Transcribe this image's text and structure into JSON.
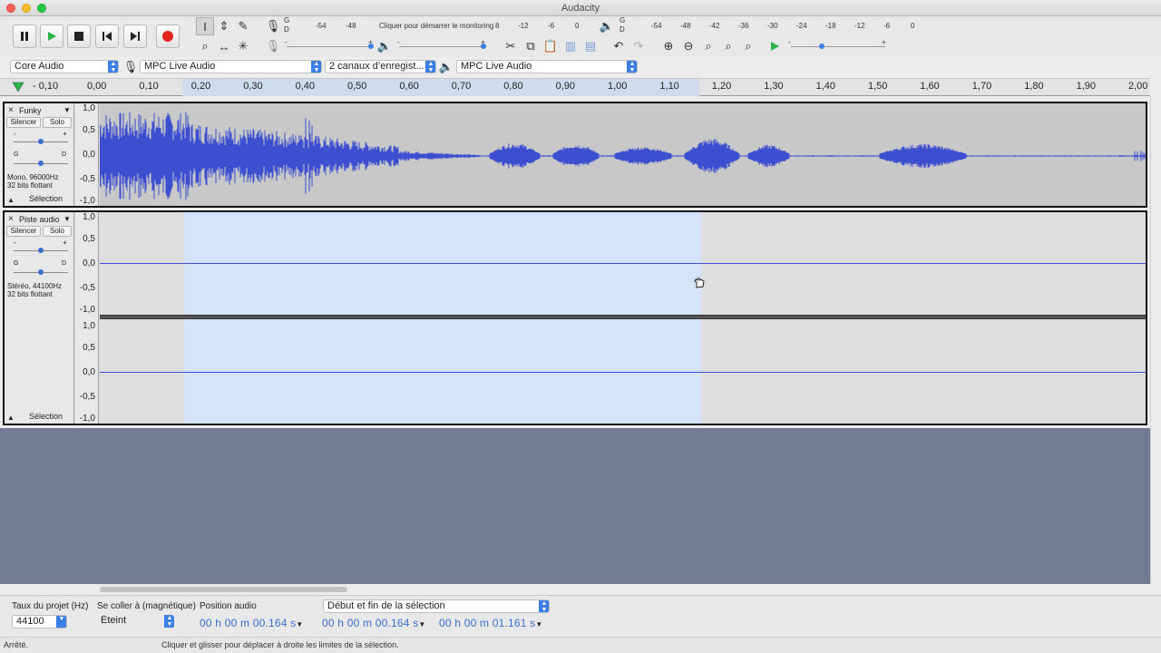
{
  "window": {
    "title": "Audacity"
  },
  "meters": {
    "record_scale": [
      "-54",
      "-48",
      "-12",
      "-6",
      "0"
    ],
    "record_hint": "Cliquer pour démarrer le monitoring",
    "record_hint_tail": "8",
    "record_L": "G",
    "record_R": "D",
    "play_scale": [
      "-54",
      "-48",
      "-42",
      "-36",
      "-30",
      "-24",
      "-18",
      "-12",
      "-6",
      "0"
    ],
    "play_L": "G",
    "play_R": "D"
  },
  "mixer": {
    "minus": "-",
    "plus": "+"
  },
  "device": {
    "host": "Core Audio",
    "input": "MPC Live Audio",
    "channels": "2 canaux d’enregist...",
    "output": "MPC Live Audio"
  },
  "ruler": {
    "ticks": [
      "- 0,10",
      "0,00",
      "0,10",
      "0,20",
      "0,30",
      "0,40",
      "0,50",
      "0,60",
      "0,70",
      "0,80",
      "0,90",
      "1,00",
      "1,10",
      "1,20",
      "1,30",
      "1,40",
      "1,50",
      "1,60",
      "1,70",
      "1,80",
      "1,90",
      "2,00"
    ]
  },
  "tracks": [
    {
      "name": "Funky",
      "close": "×",
      "mute": "Silencer",
      "solo": "Solo",
      "gain_minus": "-",
      "gain_plus": "+",
      "pan_left": "G",
      "pan_right": "D",
      "info_line1": "Mono, 96000Hz",
      "info_line2": "32 bits flottant",
      "select": "Sélection",
      "axis": [
        "1,0",
        "0,5",
        "0,0",
        "-0,5",
        "-1,0"
      ]
    },
    {
      "name": "Piste audio",
      "close": "×",
      "mute": "Silencer",
      "solo": "Solo",
      "gain_minus": "-",
      "gain_plus": "+",
      "pan_left": "G",
      "pan_right": "D",
      "info_line1": "Stéréo, 44100Hz",
      "info_line2": "32 bits flottant",
      "select": "Sélection",
      "axis_top": [
        "1,0",
        "0,5",
        "0,0",
        "-0,5",
        "-1,0"
      ],
      "axis_bottom": [
        "1,0",
        "0,5",
        "0,0",
        "-0,5",
        "-1,0"
      ]
    }
  ],
  "selection_toolbar": {
    "rate_label": "Taux du projet (Hz)",
    "rate_value": "44100",
    "snap_label": "Se coller à (magnétique)",
    "snap_value": "Éteint",
    "position_label": "Position audio",
    "position_value": "00 h 00 m 00.164 s",
    "mode_value": "Début et fin de la sélection",
    "start_value": "00 h 00 m 00.164 s",
    "end_value": "00 h 00 m 01.161 s"
  },
  "status": {
    "state": "Arrêté.",
    "message": "Cliquer et glisser pour déplacer à droite les limites de la sélection."
  },
  "colors": {
    "wave": "#3d4fd1",
    "selection": "#d5e3fb",
    "track_bg": "#dedede",
    "empty": "#727a94",
    "record": "#e2241b"
  }
}
